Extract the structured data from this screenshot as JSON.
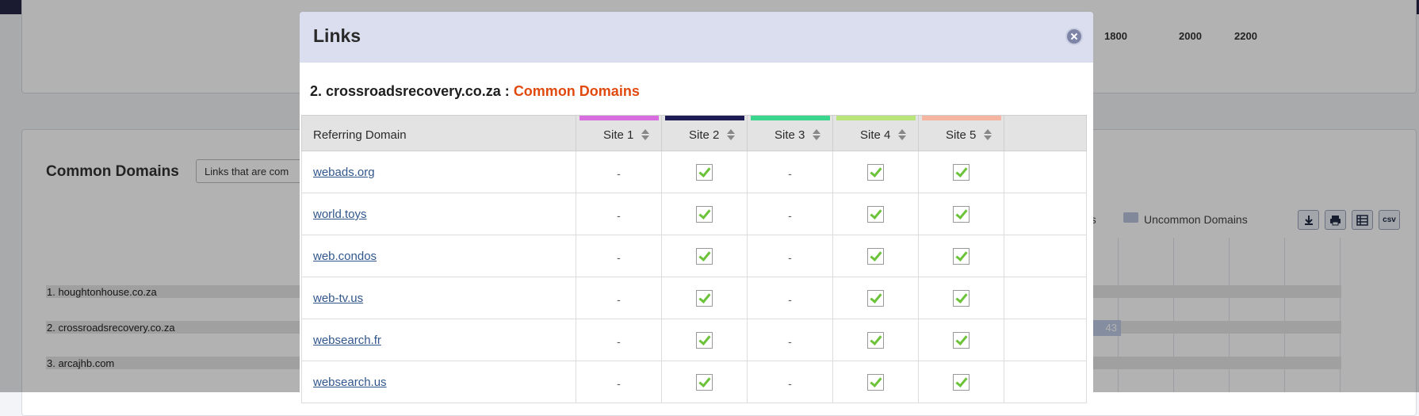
{
  "background": {
    "axis_ticks": [
      "1800",
      "2000",
      "2200"
    ],
    "common_domains_title": "Common Domains",
    "filter_select_value": "Links that are com",
    "legend": {
      "partial_common_text": "ns",
      "uncommon_text": "Uncommon Domains",
      "uncommon_color": "#b9c3db"
    },
    "toolbar_icons": [
      "download-icon",
      "print-icon",
      "table-icon",
      "csv-icon"
    ],
    "csv_label": "csv",
    "bars": [
      {
        "label": "1. houghtonhouse.co.za"
      },
      {
        "label": "2. crossroadsrecovery.co.za",
        "value": "43"
      },
      {
        "label": "3. arcajhb.com"
      }
    ]
  },
  "modal": {
    "title": "Links",
    "subtitle_prefix": "2. crossroadsrecovery.co.za : ",
    "subtitle_accent": "Common Domains",
    "accent_color": "#e04a0f",
    "columns": [
      {
        "label": "Referring Domain"
      },
      {
        "label": "Site 1",
        "color": "#d86de0"
      },
      {
        "label": "Site 2",
        "color": "#1d1c55"
      },
      {
        "label": "Site 3",
        "color": "#3bd68e"
      },
      {
        "label": "Site 4",
        "color": "#b9e57a"
      },
      {
        "label": "Site 5",
        "color": "#f6b5a0"
      }
    ],
    "rows": [
      {
        "domain": "webads.org",
        "sites": [
          false,
          true,
          false,
          true,
          true
        ]
      },
      {
        "domain": "world.toys",
        "sites": [
          false,
          true,
          false,
          true,
          true
        ]
      },
      {
        "domain": "web.condos",
        "sites": [
          false,
          true,
          false,
          true,
          true
        ]
      },
      {
        "domain": "web-tv.us",
        "sites": [
          false,
          true,
          false,
          true,
          true
        ]
      },
      {
        "domain": "websearch.fr",
        "sites": [
          false,
          true,
          false,
          true,
          true
        ]
      },
      {
        "domain": "websearch.us",
        "sites": [
          false,
          true,
          false,
          true,
          true
        ]
      }
    ],
    "dash_text": "-"
  }
}
